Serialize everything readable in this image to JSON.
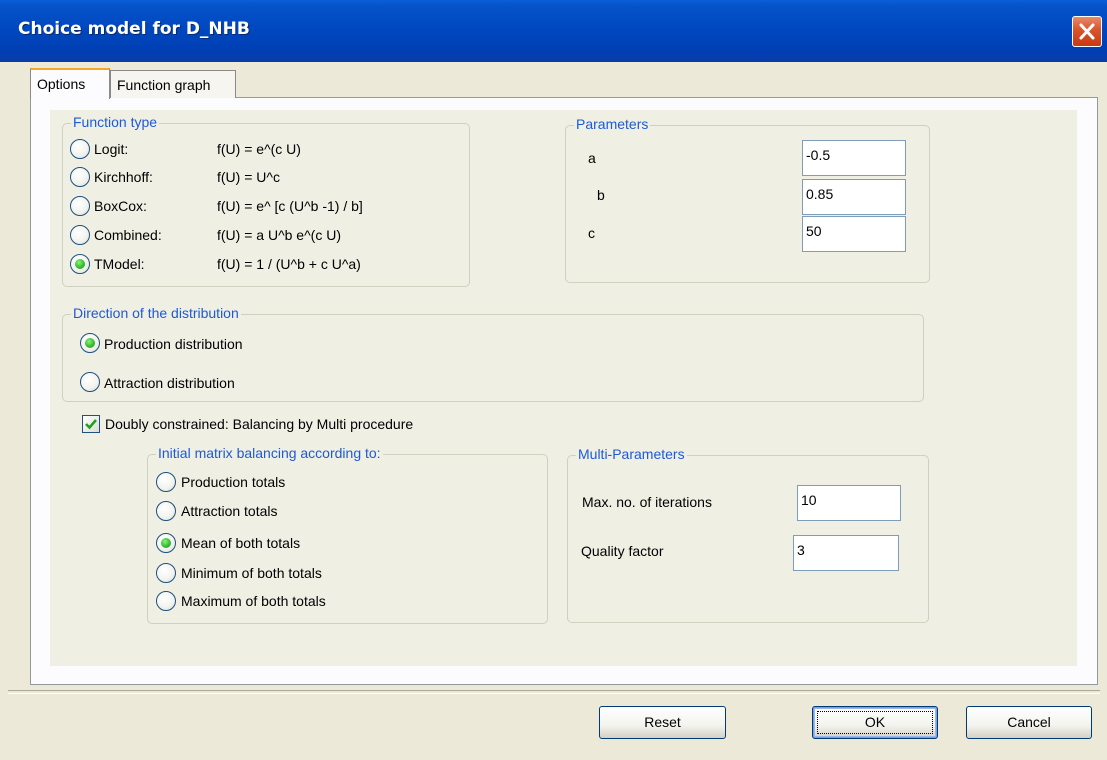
{
  "window": {
    "title": "Choice model for D_NHB"
  },
  "tabs": [
    {
      "label": "Options",
      "active": true
    },
    {
      "label": "Function graph",
      "active": false
    }
  ],
  "function_type": {
    "label": "Function type",
    "options": [
      {
        "name": "Logit:",
        "formula": "f(U) = e^(c U)",
        "selected": false
      },
      {
        "name": "Kirchhoff:",
        "formula": "f(U) = U^c",
        "selected": false
      },
      {
        "name": "BoxCox:",
        "formula": "f(U) = e^ [c (U^b -1) / b]",
        "selected": false
      },
      {
        "name": "Combined:",
        "formula": "f(U) = a U^b e^(c U)",
        "selected": false
      },
      {
        "name": "TModel:",
        "formula": "f(U) = 1 / (U^b + c U^a)",
        "selected": true
      }
    ]
  },
  "parameters": {
    "label": "Parameters",
    "rows": [
      {
        "name": "a",
        "value": "-0.5"
      },
      {
        "name": "b",
        "value": "0.85"
      },
      {
        "name": "c",
        "value": "50"
      }
    ]
  },
  "direction": {
    "label": "Direction of the distribution",
    "options": [
      {
        "label": "Production distribution",
        "selected": true
      },
      {
        "label": "Attraction distribution",
        "selected": false
      }
    ]
  },
  "doubly_constrained": {
    "label": "Doubly constrained: Balancing by Multi procedure",
    "checked": true
  },
  "initial_balancing": {
    "label": "Initial matrix balancing according to:",
    "options": [
      {
        "label": "Production totals",
        "selected": false
      },
      {
        "label": "Attraction totals",
        "selected": false
      },
      {
        "label": "Mean of both totals",
        "selected": true
      },
      {
        "label": "Minimum of both totals",
        "selected": false
      },
      {
        "label": "Maximum of both totals",
        "selected": false
      }
    ]
  },
  "multi_parameters": {
    "label": "Multi-Parameters",
    "max_iterations_label": "Max. no. of iterations",
    "max_iterations_value": "10",
    "quality_factor_label": "Quality factor",
    "quality_factor_value": "3"
  },
  "buttons": {
    "reset": "Reset",
    "ok": "OK",
    "cancel": "Cancel"
  },
  "icons": {
    "close": "close-icon",
    "checkmark": "checkmark-icon"
  },
  "colors": {
    "title_bar": "#0048c0",
    "group_label": "#1c5ad8",
    "radio_selected": "#3dc137",
    "close_button": "#d9532b"
  }
}
